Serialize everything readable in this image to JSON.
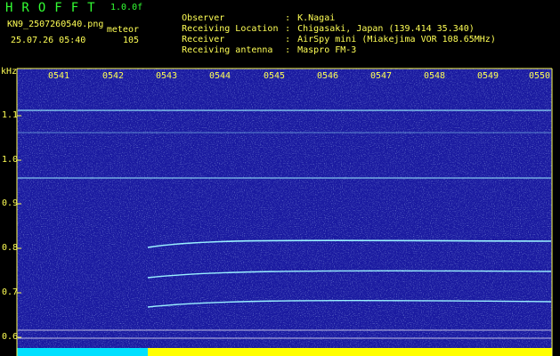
{
  "header": {
    "logo": "HROFFT",
    "version": "1.0.0f",
    "filename": "KN9_2507260540.png",
    "meteor_label": "meteor",
    "timestamp": "25.07.26 05:40",
    "meteor_count": "105",
    "meta": [
      {
        "key": "Observer",
        "value": "K.Nagai"
      },
      {
        "key": "Receiving Location",
        "value": "Chigasaki, Japan (139.414 35.340)"
      },
      {
        "key": "Receiver",
        "value": "AirSpy mini (Miakejima VOR 108.65MHz)"
      },
      {
        "key": "Receiving antenna",
        "value": "Maspro FM-3"
      }
    ]
  },
  "axis": {
    "y_unit": "kHz",
    "y_ticks": [
      "1.1",
      "1.0",
      "0.9",
      "0.8",
      "0.7",
      "0.6"
    ],
    "x_ticks": [
      "0541",
      "0542",
      "0543",
      "0544",
      "0545",
      "0546",
      "0547",
      "0548",
      "0549",
      "0550"
    ]
  },
  "colors": {
    "background": "#000000",
    "text": "#ffff55",
    "logo": "#33ff33",
    "spectrogram_bg": "#1a1aa0",
    "trace": "#9af0ff",
    "level_bar_low": "#00e0ff",
    "level_bar_high": "#ffff00"
  }
}
